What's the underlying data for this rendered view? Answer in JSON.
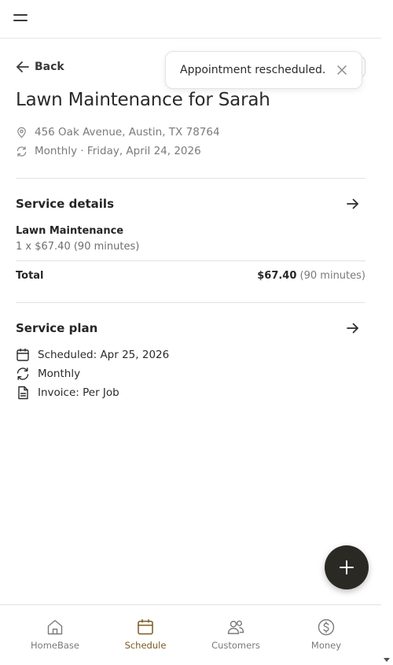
{
  "header": {
    "menu_icon": "hamburger-menu-icon"
  },
  "back": {
    "label": "Back",
    "icon": "arrow-left-icon"
  },
  "toast": {
    "message": "Appointment rescheduled.",
    "close_icon": "close-icon"
  },
  "job": {
    "title": "Lawn Maintenance for Sarah",
    "address": "456 Oak Avenue, Austin, TX 78764",
    "recurrence": "Monthly · Friday, April 24, 2026"
  },
  "service_details": {
    "title": "Service details",
    "item_name": "Lawn Maintenance",
    "item_detail": "1 x $67.40 (90 minutes)",
    "total_label": "Total",
    "total_amount": "$67.40",
    "total_duration": "(90 minutes)"
  },
  "service_plan": {
    "title": "Service plan",
    "scheduled": "Scheduled: Apr 25, 2026",
    "frequency": "Monthly",
    "invoice": "Invoice: Per Job"
  },
  "fab": {
    "icon": "plus-icon"
  },
  "nav": {
    "items": [
      {
        "label": "HomeBase",
        "icon": "home-icon"
      },
      {
        "label": "Schedule",
        "icon": "calendar-icon",
        "active": true
      },
      {
        "label": "Customers",
        "icon": "users-icon"
      },
      {
        "label": "Money",
        "icon": "dollar-circle-icon"
      }
    ]
  },
  "colors": {
    "accent": "#7a5a22",
    "fab": "#2b2924",
    "muted": "#7a7a7a"
  }
}
